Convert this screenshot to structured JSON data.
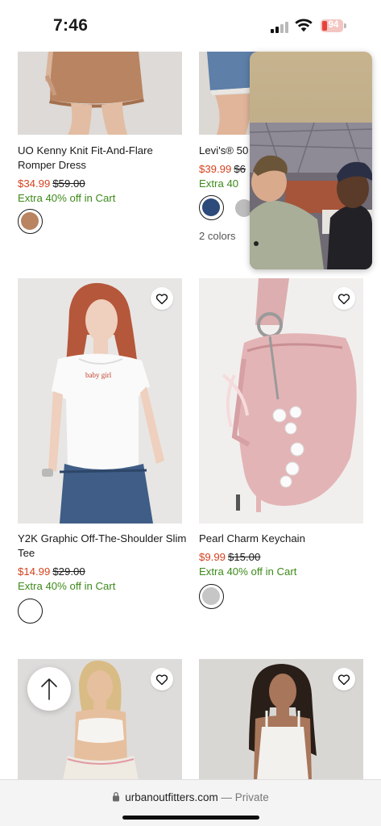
{
  "status_bar": {
    "time": "7:46",
    "battery": "94"
  },
  "products": [
    {
      "name": "UO Kenny Knit Fit-And-Flare Romper Dress",
      "sale_price": "$34.99",
      "original_price": "$59.00",
      "promo": "Extra 40% off in Cart",
      "swatch_color": "#b98461"
    },
    {
      "name": "Levi's® 50",
      "sale_price": "$39.99",
      "original_price": "$6",
      "promo": "Extra 40",
      "colors": "2 colors",
      "swatch_color": "#2c4a7a"
    },
    {
      "name": "Y2K Graphic Off-The-Shoulder Slim Tee",
      "sale_price": "$14.99",
      "original_price": "$29.00",
      "promo": "Extra 40% off in Cart",
      "tee_print": "baby girl",
      "swatch_color": "#ffffff"
    },
    {
      "name": "Pearl Charm Keychain",
      "sale_price": "$9.99",
      "original_price": "$15.00",
      "promo": "Extra 40% off in Cart",
      "swatch_color": "#c6c6c6"
    }
  ],
  "browser": {
    "domain": "urbanoutfitters.com",
    "separator": " — ",
    "mode": "Private"
  },
  "colors": {
    "sale": "#d4411f",
    "promo": "#3d8a1a"
  }
}
